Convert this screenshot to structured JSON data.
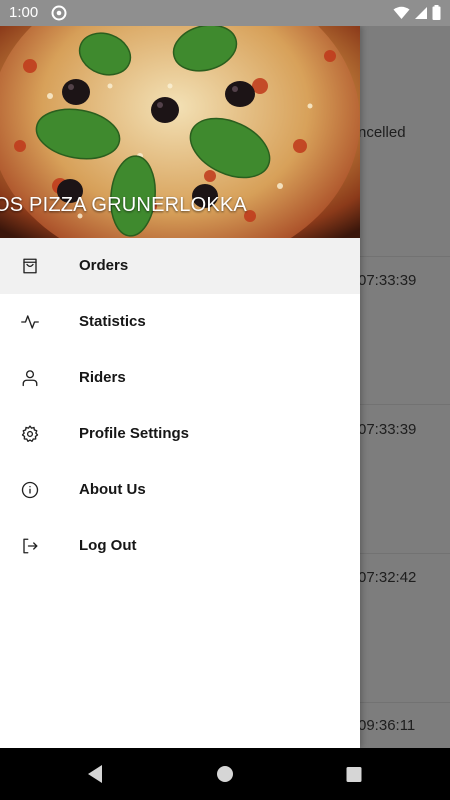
{
  "status_bar": {
    "time": "1:00",
    "icons": [
      "at-sign-icon",
      "wifi-icon",
      "signal-icon",
      "battery-icon"
    ]
  },
  "background_list": {
    "rows": [
      {
        "text": "ncelled"
      },
      {
        "text": "07:33:39"
      },
      {
        "text": "07:33:39"
      },
      {
        "text": "07:32:42"
      },
      {
        "text": "09:36:11"
      }
    ]
  },
  "drawer": {
    "store_name": "OS PIZZA GRUNERLOKKA",
    "menu": [
      {
        "label": "Orders",
        "icon": "shopping-bag-icon",
        "active": true
      },
      {
        "label": "Statistics",
        "icon": "activity-icon",
        "active": false
      },
      {
        "label": "Riders",
        "icon": "user-icon",
        "active": false
      },
      {
        "label": "Profile Settings",
        "icon": "gear-icon",
        "active": false
      },
      {
        "label": "About Us",
        "icon": "info-icon",
        "active": false
      },
      {
        "label": "Log Out",
        "icon": "log-out-icon",
        "active": false
      }
    ]
  },
  "nav_bar": {
    "buttons": [
      "back-icon",
      "home-icon",
      "recents-icon"
    ]
  },
  "colors": {
    "drawer_bg": "#ffffff",
    "active_item_bg": "#f1f1f1",
    "scrim": "#7d7d7d",
    "text": "#161616"
  }
}
